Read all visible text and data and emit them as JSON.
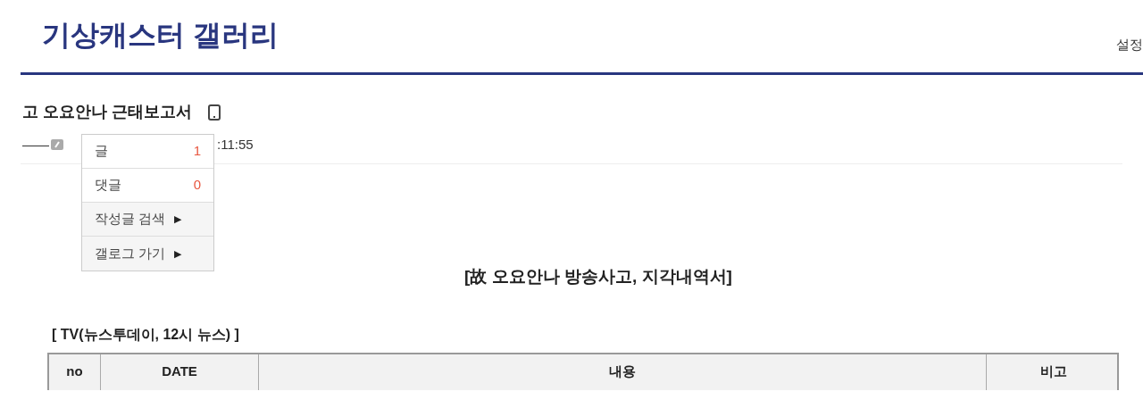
{
  "header": {
    "title": "기상캐스터 갤러리",
    "settings_link": "설정"
  },
  "post": {
    "title": "고 오요안나 근태보고서",
    "author": "——",
    "time": ":11:55"
  },
  "user_menu": {
    "items": [
      {
        "kind": "count",
        "label": "글",
        "count": "1"
      },
      {
        "kind": "count",
        "label": "댓글",
        "count": "0"
      },
      {
        "kind": "submenu",
        "label": "작성글 검색",
        "arrow": "▶"
      },
      {
        "kind": "submenu",
        "label": "갤로그 가기",
        "arrow": "▶"
      }
    ]
  },
  "body": {
    "heading": "[故 오요안나 방송사고, 지각내역서]",
    "section_title": "[ TV(뉴스투데이, 12시 뉴스) ]",
    "table": {
      "columns": [
        "no",
        "DATE",
        "내용",
        "비고"
      ]
    }
  }
}
